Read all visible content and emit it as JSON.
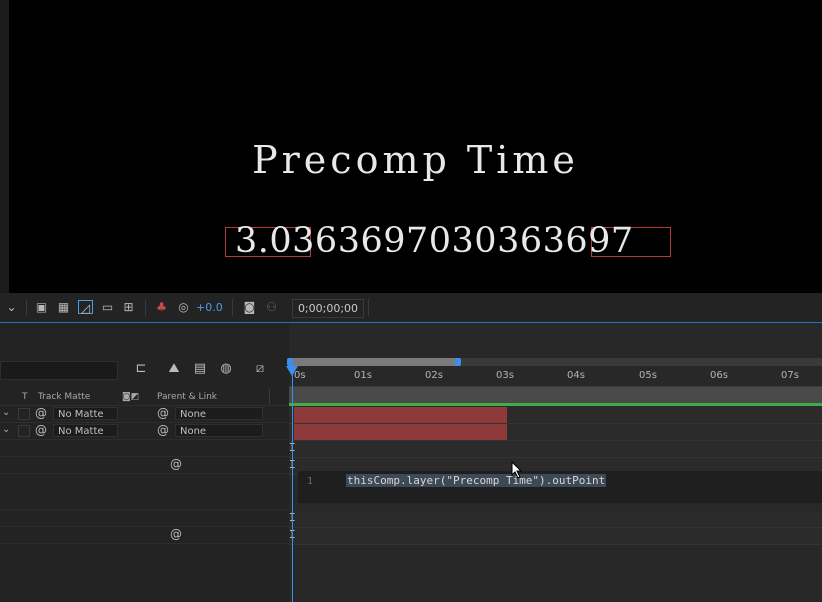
{
  "viewer": {
    "title": "Precomp Time",
    "value": "3.0363697030363697",
    "exposure": "+0.0",
    "timecode": "0;00;00;00"
  },
  "columns": {
    "t": "T",
    "track_matte": "Track Matte",
    "parent_link": "Parent & Link"
  },
  "layers": [
    {
      "matte": "No Matte",
      "parent": "None"
    },
    {
      "matte": "No Matte",
      "parent": "None"
    }
  ],
  "ruler": {
    "ticks": [
      "0s",
      "01s",
      "02s",
      "03s",
      "04s",
      "05s",
      "06s",
      "07s"
    ]
  },
  "expression": {
    "line_number": "1",
    "code": "thisComp.layer(\"Precomp Time\").outPoint"
  },
  "colors": {
    "accent": "#3b8ff0",
    "clip": "#8e3a3a",
    "highlight_box": "#b53a3a",
    "audio_bar": "#3fae48"
  },
  "icons": [
    "chevron-down-icon",
    "snapshot-icon",
    "transparency-grid-icon",
    "mask-icon",
    "region-icon",
    "guides-icon",
    "color-channel-icon",
    "exposure-reset-icon",
    "camera-icon",
    "show-snapshot-icon",
    "comp-flowchart-icon",
    "shy-icon",
    "frame-blending-icon",
    "motion-blur-icon",
    "graph-editor-icon",
    "pick-whip-icon",
    "cursor-arrow-icon"
  ]
}
